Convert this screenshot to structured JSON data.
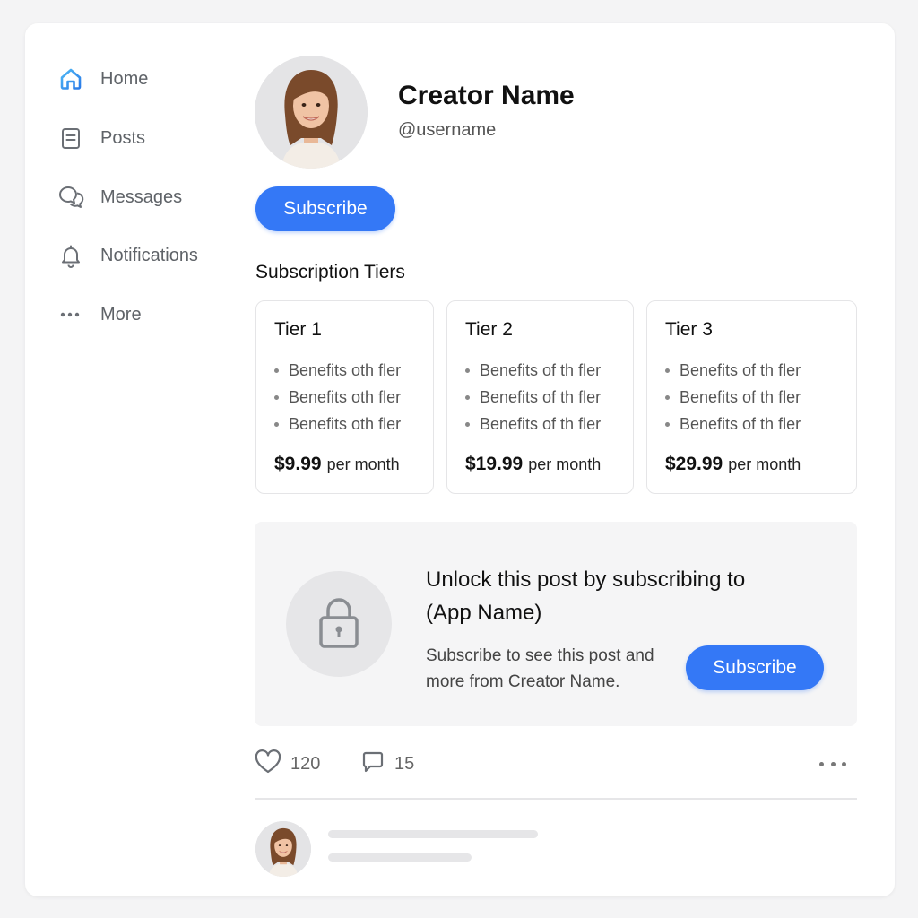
{
  "sidebar": {
    "items": [
      {
        "label": "Home",
        "icon": "home-icon",
        "active": true
      },
      {
        "label": "Posts",
        "icon": "posts-icon"
      },
      {
        "label": "Messages",
        "icon": "messages-icon"
      },
      {
        "label": "Notifications",
        "icon": "bell-icon"
      },
      {
        "label": "More",
        "icon": "more-icon"
      }
    ]
  },
  "profile": {
    "name": "Creator Name",
    "handle": "@username",
    "subscribe_label": "Subscribe"
  },
  "tiers": {
    "title": "Subscription Tiers",
    "items": [
      {
        "name": "Tier 1",
        "benefits": [
          "Benefits oth fler",
          "Benefits oth fler",
          "Benefits oth fler"
        ],
        "price": "$9.99",
        "period": "per month"
      },
      {
        "name": "Tier 2",
        "benefits": [
          "Benefits of th fler",
          "Benefits of th fler",
          "Benefits of th fler"
        ],
        "price": "$19.99",
        "period": "per month"
      },
      {
        "name": "Tier 3",
        "benefits": [
          "Benefits of th fler",
          "Benefits of th fler",
          "Benefits of th fler"
        ],
        "price": "$29.99",
        "period": "per month"
      }
    ]
  },
  "locked_post": {
    "title": "Unlock this post by subscribing to (App Name)",
    "text": "Subscribe to see this post and more from Creator Name.",
    "subscribe_label": "Subscribe"
  },
  "post_actions": {
    "likes": "120",
    "comments": "15"
  },
  "colors": {
    "accent": "#3478f6",
    "home_icon": "#2f9bf0"
  }
}
